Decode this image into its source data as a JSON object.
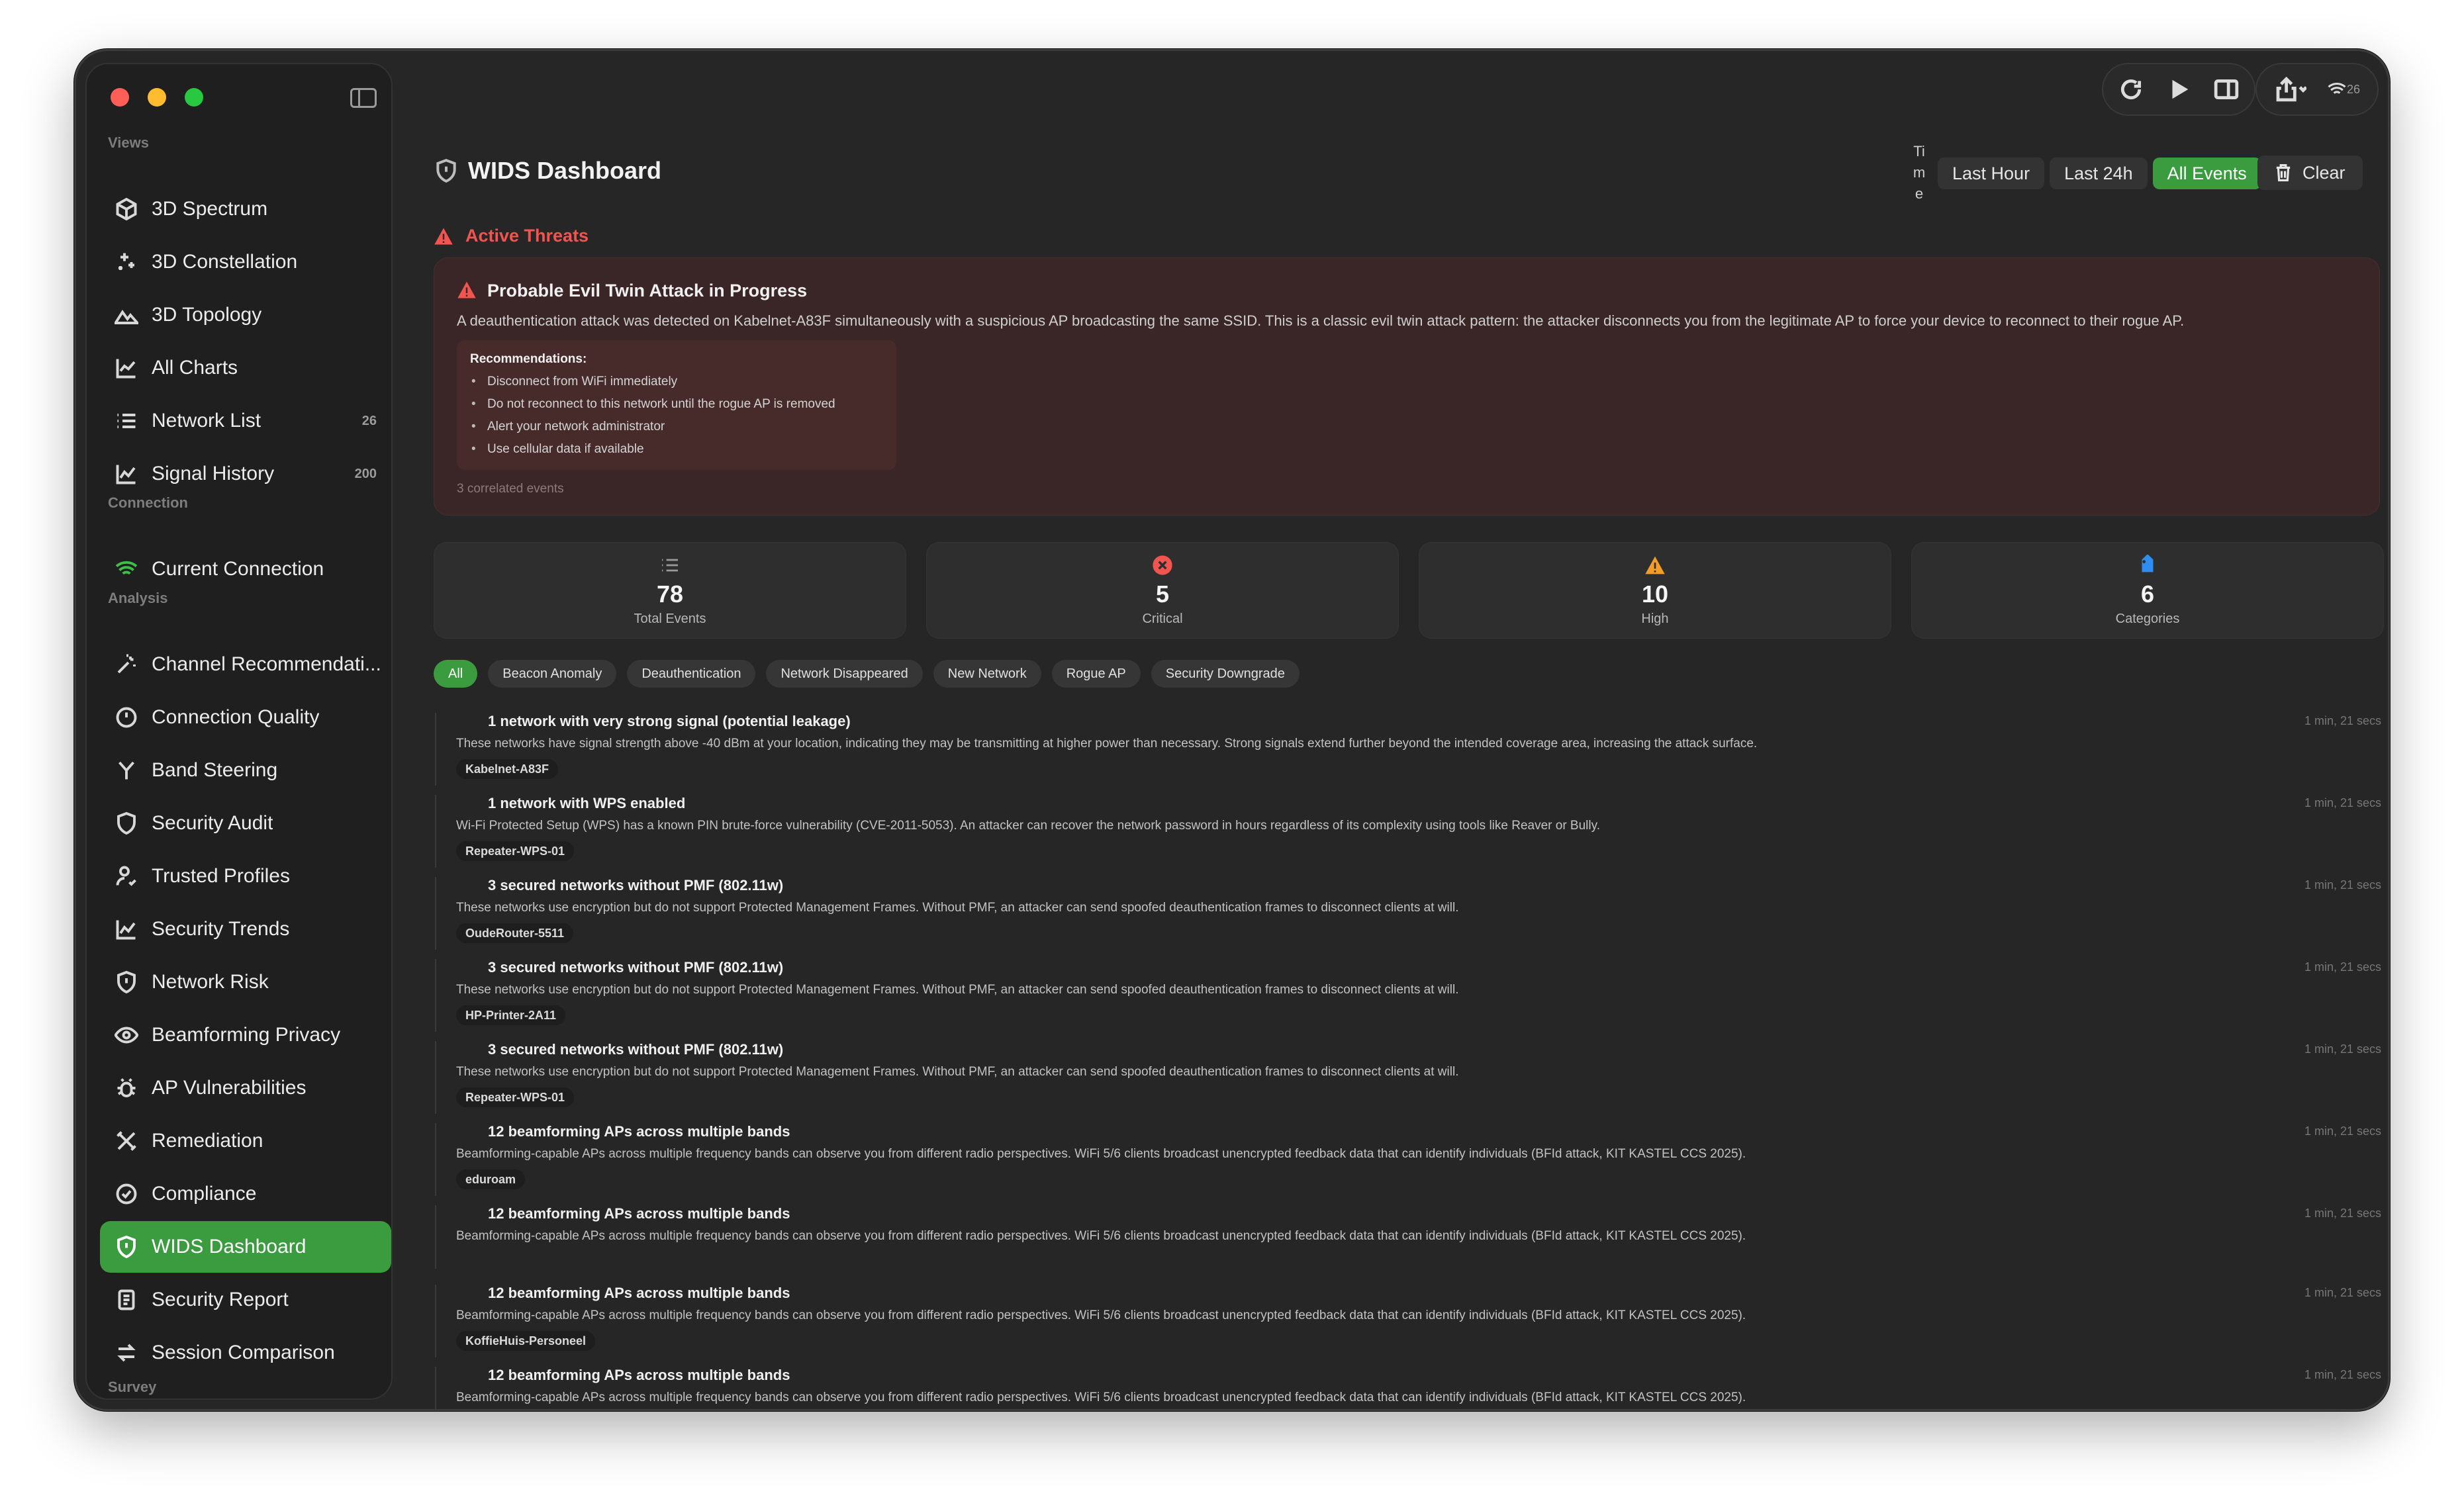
{
  "sidebar": {
    "sections": {
      "views": "Views",
      "connection": "Connection",
      "analysis": "Analysis",
      "survey": "Survey"
    },
    "items": [
      {
        "label": "3D Spectrum",
        "icon": "cube-icon",
        "badge": ""
      },
      {
        "label": "3D Constellation",
        "icon": "sparkles-icon",
        "badge": ""
      },
      {
        "label": "3D Topology",
        "icon": "mountains-icon",
        "badge": ""
      },
      {
        "label": "All Charts",
        "icon": "line-chart-icon",
        "badge": ""
      },
      {
        "label": "Network List",
        "icon": "list-icon",
        "badge": "26"
      },
      {
        "label": "Signal History",
        "icon": "trend-chart-icon",
        "badge": "200"
      },
      {
        "label": "Current Connection",
        "icon": "wifi-icon",
        "badge": ""
      },
      {
        "label": "Channel Recommendati...",
        "icon": "wand-icon",
        "badge": ""
      },
      {
        "label": "Connection Quality",
        "icon": "gauge-icon",
        "badge": ""
      },
      {
        "label": "Band Steering",
        "icon": "fork-icon",
        "badge": ""
      },
      {
        "label": "Security Audit",
        "icon": "shield-icon",
        "badge": ""
      },
      {
        "label": "Trusted Profiles",
        "icon": "person-check-icon",
        "badge": ""
      },
      {
        "label": "Security Trends",
        "icon": "trend-chart-icon",
        "badge": ""
      },
      {
        "label": "Network Risk",
        "icon": "shield-alert-icon",
        "badge": ""
      },
      {
        "label": "Beamforming Privacy",
        "icon": "eye-icon",
        "badge": ""
      },
      {
        "label": "AP Vulnerabilities",
        "icon": "bug-icon",
        "badge": ""
      },
      {
        "label": "Remediation",
        "icon": "tools-icon",
        "badge": ""
      },
      {
        "label": "Compliance",
        "icon": "checkmark-seal-icon",
        "badge": ""
      },
      {
        "label": "WIDS Dashboard",
        "icon": "shield-alert-icon",
        "badge": ""
      },
      {
        "label": "Security Report",
        "icon": "document-icon",
        "badge": ""
      },
      {
        "label": "Session Comparison",
        "icon": "arrows-swap-icon",
        "badge": ""
      }
    ]
  },
  "toolbar": {
    "wifi_count": "26"
  },
  "header": {
    "title": "WIDS Dashboard",
    "time_label_chars": [
      "Ti",
      "m",
      "e"
    ],
    "time_options": [
      "Last Hour",
      "Last 24h",
      "All Events"
    ],
    "time_selected": "All Events",
    "clear_label": "Clear"
  },
  "threats": {
    "heading": "Active Threats",
    "card": {
      "title": "Probable Evil Twin Attack in Progress",
      "description": "A deauthentication attack was detected on Kabelnet-A83F simultaneously with a suspicious AP broadcasting the same SSID. This is a classic evil twin attack pattern: the attacker disconnects you from the legitimate AP to force your device to reconnect to their rogue AP.",
      "recommendations_label": "Recommendations:",
      "recommendations": [
        "Disconnect from WiFi immediately",
        "Do not reconnect to this network until the rogue AP is removed",
        "Alert your network administrator",
        "Use cellular data if available"
      ],
      "footer": "3 correlated events"
    }
  },
  "stats": [
    {
      "value": "78",
      "label": "Total Events",
      "icon": "list-icon",
      "color": "#9a9a9a"
    },
    {
      "value": "5",
      "label": "Critical",
      "icon": "x-circle-icon",
      "color": "#f2544f"
    },
    {
      "value": "10",
      "label": "High",
      "icon": "warning-triangle-icon",
      "color": "#f39c2a"
    },
    {
      "value": "6",
      "label": "Categories",
      "icon": "tag-icon",
      "color": "#2f8df2"
    }
  ],
  "filters": {
    "selected": "All",
    "chips": [
      "All",
      "Beacon Anomaly",
      "Deauthentication",
      "Network Disappeared",
      "New Network",
      "Rogue AP",
      "Security Downgrade"
    ]
  },
  "events": [
    {
      "title": "1 network with very strong signal (potential leakage)",
      "description": "These networks have signal strength above -40 dBm at your location, indicating they may be transmitting at higher power than necessary. Strong signals extend further beyond the intended coverage area, increasing the attack surface.",
      "tag": "Kabelnet-A83F",
      "time": "1 min, 21 secs"
    },
    {
      "title": "1 network with WPS enabled",
      "description": "Wi-Fi Protected Setup (WPS) has a known PIN brute-force vulnerability (CVE-2011-5053). An attacker can recover the network password in hours regardless of its complexity using tools like Reaver or Bully.",
      "tag": "Repeater-WPS-01",
      "time": "1 min, 21 secs"
    },
    {
      "title": "3 secured networks without PMF (802.11w)",
      "description": "These networks use encryption but do not support Protected Management Frames. Without PMF, an attacker can send spoofed deauthentication frames to disconnect clients at will.",
      "tag": "OudeRouter-5511",
      "time": "1 min, 21 secs"
    },
    {
      "title": "3 secured networks without PMF (802.11w)",
      "description": "These networks use encryption but do not support Protected Management Frames. Without PMF, an attacker can send spoofed deauthentication frames to disconnect clients at will.",
      "tag": "HP-Printer-2A11",
      "time": "1 min, 21 secs"
    },
    {
      "title": "3 secured networks without PMF (802.11w)",
      "description": "These networks use encryption but do not support Protected Management Frames. Without PMF, an attacker can send spoofed deauthentication frames to disconnect clients at will.",
      "tag": "Repeater-WPS-01",
      "time": "1 min, 21 secs"
    },
    {
      "title": "12 beamforming APs across multiple bands",
      "description": "Beamforming-capable APs across multiple frequency bands can observe you from different radio perspectives. WiFi 5/6 clients broadcast unencrypted feedback data that can identify individuals (BFId attack, KIT KASTEL CCS 2025).",
      "tag": "eduroam",
      "time": "1 min, 21 secs"
    },
    {
      "title": "12 beamforming APs across multiple bands",
      "description": "Beamforming-capable APs across multiple frequency bands can observe you from different radio perspectives. WiFi 5/6 clients broadcast unencrypted feedback data that can identify individuals (BFId attack, KIT KASTEL CCS 2025).",
      "tag": "",
      "time": "1 min, 21 secs"
    },
    {
      "title": "12 beamforming APs across multiple bands",
      "description": "Beamforming-capable APs across multiple frequency bands can observe you from different radio perspectives. WiFi 5/6 clients broadcast unencrypted feedback data that can identify individuals (BFId attack, KIT KASTEL CCS 2025).",
      "tag": "KoffieHuis-Personeel",
      "time": "1 min, 21 secs"
    },
    {
      "title": "12 beamforming APs across multiple bands",
      "description": "Beamforming-capable APs across multiple frequency bands can observe you from different radio perspectives. WiFi 5/6 clients broadcast unencrypted feedback data that can identify individuals (BFId attack, KIT KASTEL CCS 2025).",
      "tag": "",
      "time": "1 min, 21 secs"
    }
  ],
  "colors": {
    "accent_green": "#3b9b3f",
    "critical_red": "#f2544f",
    "high_orange": "#f39c2a",
    "category_blue": "#2f8df2"
  }
}
